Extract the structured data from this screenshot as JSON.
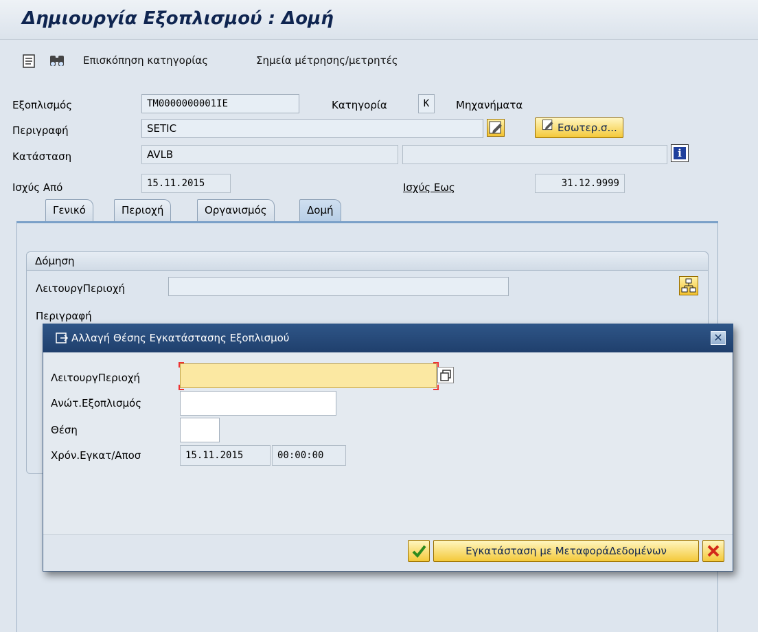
{
  "title": "Δημιουργία Εξοπλισμού : Δομή",
  "toolbar": {
    "items": [
      "Επισκόπηση κατηγορίας",
      "Σημεία μέτρησης/μετρητές"
    ]
  },
  "header": {
    "equipment_label": "Εξοπλισμός",
    "equipment_value": "TM0000000001IE",
    "category_label": "Κατηγορία",
    "category_code": "K",
    "category_text": "Μηχανήματα",
    "description_label": "Περιγραφή",
    "description_value": "SETIC",
    "internal_note_button": "Εσωτερ.σ...",
    "status_label": "Κατάσταση",
    "status_value": "AVLB",
    "status_desc_value": "",
    "valid_from_label": "Ισχύς Από",
    "valid_from_value": "15.11.2015",
    "valid_to_label": "Ισχύς Εως",
    "valid_to_value": "31.12.9999"
  },
  "tabs": [
    "Γενικό",
    "Περιοχή",
    "Οργανισμός",
    "Δομή"
  ],
  "active_tab": "Δομή",
  "structure": {
    "group_title": "Δόμηση",
    "functional_location_label": "ΛειτουργΠεριοχή",
    "functional_location_value": "",
    "description_label": "Περιγραφή"
  },
  "dialog": {
    "title": "Αλλαγή Θέσης Εγκατάστασης Εξοπλισμού",
    "functional_location_label": "ΛειτουργΠεριοχή",
    "functional_location_value": "",
    "superior_equipment_label": "Ανώτ.Εξοπλισμός",
    "superior_equipment_value": "",
    "position_label": "Θέση",
    "position_value": "",
    "install_time_label": "Χρόν.Εγκατ/Αποσ",
    "install_date_value": "15.11.2015",
    "install_time_value": "00:00:00",
    "install_button": "Εγκατάσταση με ΜεταφοράΔεδομένων"
  },
  "colors": {
    "title_text": "#0f2550",
    "dialog_titlebar": "#2f5688",
    "focus_field": "#fbe8a2",
    "button_yellow": "#f4c93a"
  }
}
